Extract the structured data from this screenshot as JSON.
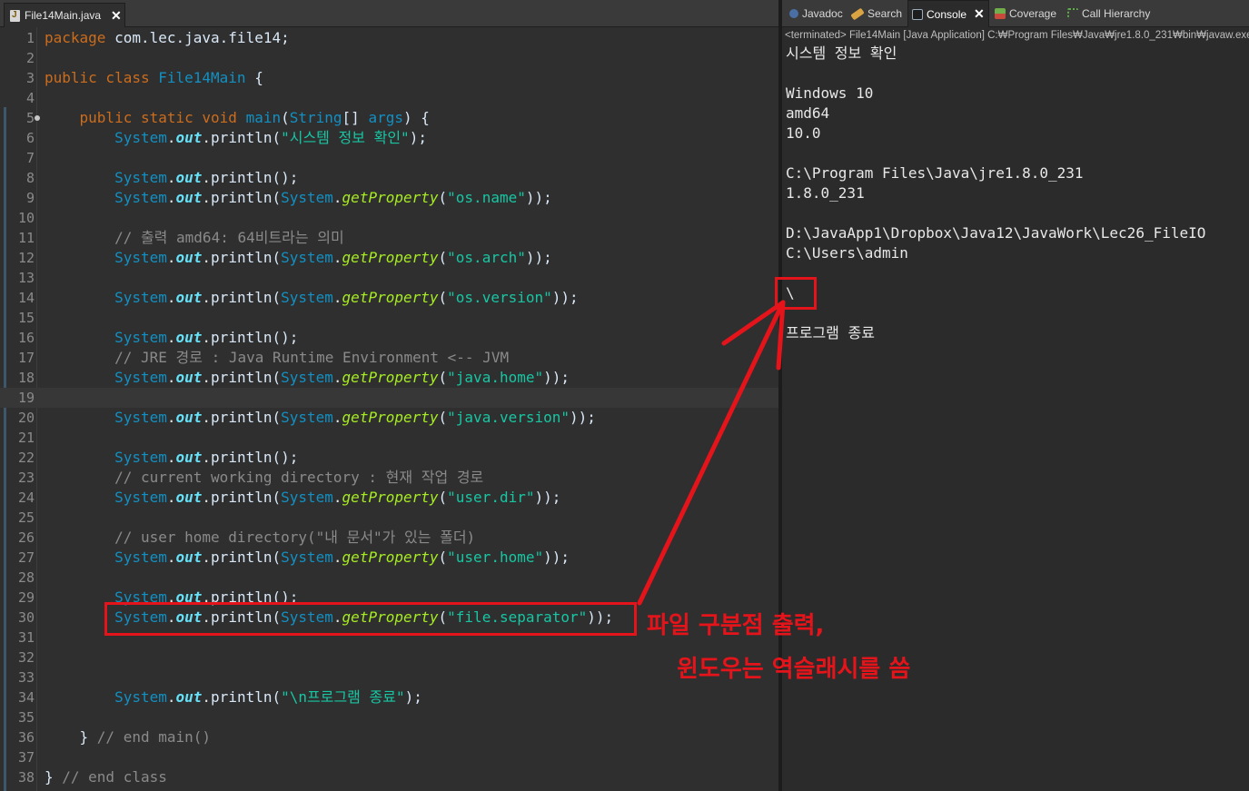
{
  "editor": {
    "tab_title": "File14Main.java",
    "close_glyph": "✕",
    "lines": [
      {
        "n": "1",
        "segs": [
          [
            "kw",
            "package"
          ],
          [
            "txt",
            " com.lec.java.file14;"
          ]
        ]
      },
      {
        "n": "2",
        "segs": []
      },
      {
        "n": "3",
        "segs": [
          [
            "kw",
            "public class "
          ],
          [
            "cls",
            "File14Main"
          ],
          [
            "txt",
            " {"
          ]
        ]
      },
      {
        "n": "4",
        "segs": []
      },
      {
        "n": "5",
        "fold": true,
        "segs": [
          [
            "txt",
            "    "
          ],
          [
            "kw",
            "public static void "
          ],
          [
            "mth2",
            "main"
          ],
          [
            "txt",
            "("
          ],
          [
            "cls",
            "String"
          ],
          [
            "txt",
            "[] "
          ],
          [
            "cls",
            "args"
          ],
          [
            "txt",
            ") {"
          ]
        ]
      },
      {
        "n": "6",
        "segs": [
          [
            "txt",
            "        "
          ],
          [
            "cls",
            "System"
          ],
          [
            "dot",
            "."
          ],
          [
            "fld",
            "out"
          ],
          [
            "dot",
            "."
          ],
          [
            "txt",
            "println("
          ],
          [
            "str",
            "\"시스템 정보 확인\""
          ],
          [
            "txt",
            ");"
          ]
        ]
      },
      {
        "n": "7",
        "segs": []
      },
      {
        "n": "8",
        "segs": [
          [
            "txt",
            "        "
          ],
          [
            "cls",
            "System"
          ],
          [
            "dot",
            "."
          ],
          [
            "fld",
            "out"
          ],
          [
            "dot",
            "."
          ],
          [
            "txt",
            "println();"
          ]
        ]
      },
      {
        "n": "9",
        "segs": [
          [
            "txt",
            "        "
          ],
          [
            "cls",
            "System"
          ],
          [
            "dot",
            "."
          ],
          [
            "fld",
            "out"
          ],
          [
            "dot",
            "."
          ],
          [
            "txt",
            "println("
          ],
          [
            "cls",
            "System"
          ],
          [
            "dot",
            "."
          ],
          [
            "mth",
            "getProperty"
          ],
          [
            "txt",
            "("
          ],
          [
            "str",
            "\"os.name\""
          ],
          [
            "txt",
            "));"
          ]
        ]
      },
      {
        "n": "10",
        "segs": []
      },
      {
        "n": "11",
        "segs": [
          [
            "txt",
            "        "
          ],
          [
            "cmt",
            "// 출력 amd64: 64비트라는 의미"
          ]
        ]
      },
      {
        "n": "12",
        "segs": [
          [
            "txt",
            "        "
          ],
          [
            "cls",
            "System"
          ],
          [
            "dot",
            "."
          ],
          [
            "fld",
            "out"
          ],
          [
            "dot",
            "."
          ],
          [
            "txt",
            "println("
          ],
          [
            "cls",
            "System"
          ],
          [
            "dot",
            "."
          ],
          [
            "mth",
            "getProperty"
          ],
          [
            "txt",
            "("
          ],
          [
            "str",
            "\"os.arch\""
          ],
          [
            "txt",
            "));"
          ]
        ]
      },
      {
        "n": "13",
        "segs": []
      },
      {
        "n": "14",
        "segs": [
          [
            "txt",
            "        "
          ],
          [
            "cls",
            "System"
          ],
          [
            "dot",
            "."
          ],
          [
            "fld",
            "out"
          ],
          [
            "dot",
            "."
          ],
          [
            "txt",
            "println("
          ],
          [
            "cls",
            "System"
          ],
          [
            "dot",
            "."
          ],
          [
            "mth",
            "getProperty"
          ],
          [
            "txt",
            "("
          ],
          [
            "str",
            "\"os.version\""
          ],
          [
            "txt",
            "));"
          ]
        ]
      },
      {
        "n": "15",
        "segs": []
      },
      {
        "n": "16",
        "segs": [
          [
            "txt",
            "        "
          ],
          [
            "cls",
            "System"
          ],
          [
            "dot",
            "."
          ],
          [
            "fld",
            "out"
          ],
          [
            "dot",
            "."
          ],
          [
            "txt",
            "println();"
          ]
        ]
      },
      {
        "n": "17",
        "segs": [
          [
            "txt",
            "        "
          ],
          [
            "cmt",
            "// JRE 경로 : Java Runtime Environment <-- JVM"
          ]
        ]
      },
      {
        "n": "18",
        "segs": [
          [
            "txt",
            "        "
          ],
          [
            "cls",
            "System"
          ],
          [
            "dot",
            "."
          ],
          [
            "fld",
            "out"
          ],
          [
            "dot",
            "."
          ],
          [
            "txt",
            "println("
          ],
          [
            "cls",
            "System"
          ],
          [
            "dot",
            "."
          ],
          [
            "mth",
            "getProperty"
          ],
          [
            "txt",
            "("
          ],
          [
            "str",
            "\"java.home\""
          ],
          [
            "txt",
            "));"
          ]
        ]
      },
      {
        "n": "19",
        "current": true,
        "segs": []
      },
      {
        "n": "20",
        "segs": [
          [
            "txt",
            "        "
          ],
          [
            "cls",
            "System"
          ],
          [
            "dot",
            "."
          ],
          [
            "fld",
            "out"
          ],
          [
            "dot",
            "."
          ],
          [
            "txt",
            "println("
          ],
          [
            "cls",
            "System"
          ],
          [
            "dot",
            "."
          ],
          [
            "mth",
            "getProperty"
          ],
          [
            "txt",
            "("
          ],
          [
            "str",
            "\"java.version\""
          ],
          [
            "txt",
            "));"
          ]
        ]
      },
      {
        "n": "21",
        "segs": []
      },
      {
        "n": "22",
        "segs": [
          [
            "txt",
            "        "
          ],
          [
            "cls",
            "System"
          ],
          [
            "dot",
            "."
          ],
          [
            "fld",
            "out"
          ],
          [
            "dot",
            "."
          ],
          [
            "txt",
            "println();"
          ]
        ]
      },
      {
        "n": "23",
        "segs": [
          [
            "txt",
            "        "
          ],
          [
            "cmt",
            "// current working directory : 현재 작업 경로"
          ]
        ]
      },
      {
        "n": "24",
        "segs": [
          [
            "txt",
            "        "
          ],
          [
            "cls",
            "System"
          ],
          [
            "dot",
            "."
          ],
          [
            "fld",
            "out"
          ],
          [
            "dot",
            "."
          ],
          [
            "txt",
            "println("
          ],
          [
            "cls",
            "System"
          ],
          [
            "dot",
            "."
          ],
          [
            "mth",
            "getProperty"
          ],
          [
            "txt",
            "("
          ],
          [
            "str",
            "\"user.dir\""
          ],
          [
            "txt",
            "));"
          ]
        ]
      },
      {
        "n": "25",
        "segs": []
      },
      {
        "n": "26",
        "segs": [
          [
            "txt",
            "        "
          ],
          [
            "cmt",
            "// user home directory(\"내 문서\"가 있는 폴더)"
          ]
        ]
      },
      {
        "n": "27",
        "segs": [
          [
            "txt",
            "        "
          ],
          [
            "cls",
            "System"
          ],
          [
            "dot",
            "."
          ],
          [
            "fld",
            "out"
          ],
          [
            "dot",
            "."
          ],
          [
            "txt",
            "println("
          ],
          [
            "cls",
            "System"
          ],
          [
            "dot",
            "."
          ],
          [
            "mth",
            "getProperty"
          ],
          [
            "txt",
            "("
          ],
          [
            "str",
            "\"user.home\""
          ],
          [
            "txt",
            "));"
          ]
        ]
      },
      {
        "n": "28",
        "segs": []
      },
      {
        "n": "29",
        "segs": [
          [
            "txt",
            "        "
          ],
          [
            "cls",
            "System"
          ],
          [
            "dot",
            "."
          ],
          [
            "fld",
            "out"
          ],
          [
            "dot",
            "."
          ],
          [
            "txt",
            "println();"
          ]
        ]
      },
      {
        "n": "30",
        "segs": [
          [
            "txt",
            "        "
          ],
          [
            "cls",
            "System"
          ],
          [
            "dot",
            "."
          ],
          [
            "fld",
            "out"
          ],
          [
            "dot",
            "."
          ],
          [
            "txt",
            "println("
          ],
          [
            "cls",
            "System"
          ],
          [
            "dot",
            "."
          ],
          [
            "mth",
            "getProperty"
          ],
          [
            "txt",
            "("
          ],
          [
            "str",
            "\"file.separator\""
          ],
          [
            "txt",
            "));"
          ]
        ]
      },
      {
        "n": "31",
        "segs": []
      },
      {
        "n": "32",
        "segs": []
      },
      {
        "n": "33",
        "segs": []
      },
      {
        "n": "34",
        "segs": [
          [
            "txt",
            "        "
          ],
          [
            "cls",
            "System"
          ],
          [
            "dot",
            "."
          ],
          [
            "fld",
            "out"
          ],
          [
            "dot",
            "."
          ],
          [
            "txt",
            "println("
          ],
          [
            "str",
            "\"\\n프로그램 종료\""
          ],
          [
            "txt",
            ");"
          ]
        ]
      },
      {
        "n": "35",
        "segs": []
      },
      {
        "n": "36",
        "segs": [
          [
            "txt",
            "    } "
          ],
          [
            "cmt",
            "// end main()"
          ]
        ]
      },
      {
        "n": "37",
        "segs": []
      },
      {
        "n": "38",
        "segs": [
          [
            "txt",
            "} "
          ],
          [
            "cmt",
            "// end class"
          ]
        ]
      }
    ]
  },
  "console": {
    "tabs": [
      {
        "label": "Javadoc",
        "icon": "javadoc-icon",
        "active": false
      },
      {
        "label": "Search",
        "icon": "search-icon",
        "active": false
      },
      {
        "label": "Console",
        "icon": "console-icon",
        "active": true
      },
      {
        "label": "Coverage",
        "icon": "coverage-icon",
        "active": false
      },
      {
        "label": "Call Hierarchy",
        "icon": "call-hierarchy-icon",
        "active": false
      }
    ],
    "close_glyph": "✕",
    "status": "<terminated> File14Main [Java Application] C:₩Program Files₩Java₩jre1.8.0_231₩bin₩javaw.exe",
    "output": [
      "시스템 정보 확인",
      "",
      "Windows 10",
      "amd64",
      "10.0",
      "",
      "C:\\Program Files\\Java\\jre1.8.0_231",
      "1.8.0_231",
      "",
      "D:\\JavaApp1\\Dropbox\\Java12\\JavaWork\\Lec26_FileIO",
      "C:\\Users\\admin",
      "",
      "\\",
      "",
      "프로그램 종료"
    ]
  },
  "annotation": {
    "line1": "파일 구분점 출력,",
    "line2": "윈도우는 역슬래시를 씀",
    "color": "#e5141b"
  },
  "colors": {
    "keyword": "#cc6c1d",
    "class": "#1290c3",
    "field": "#66e1f8",
    "method": "#a7ec21",
    "string": "#17c6a3",
    "comment": "#8a8a8a"
  }
}
